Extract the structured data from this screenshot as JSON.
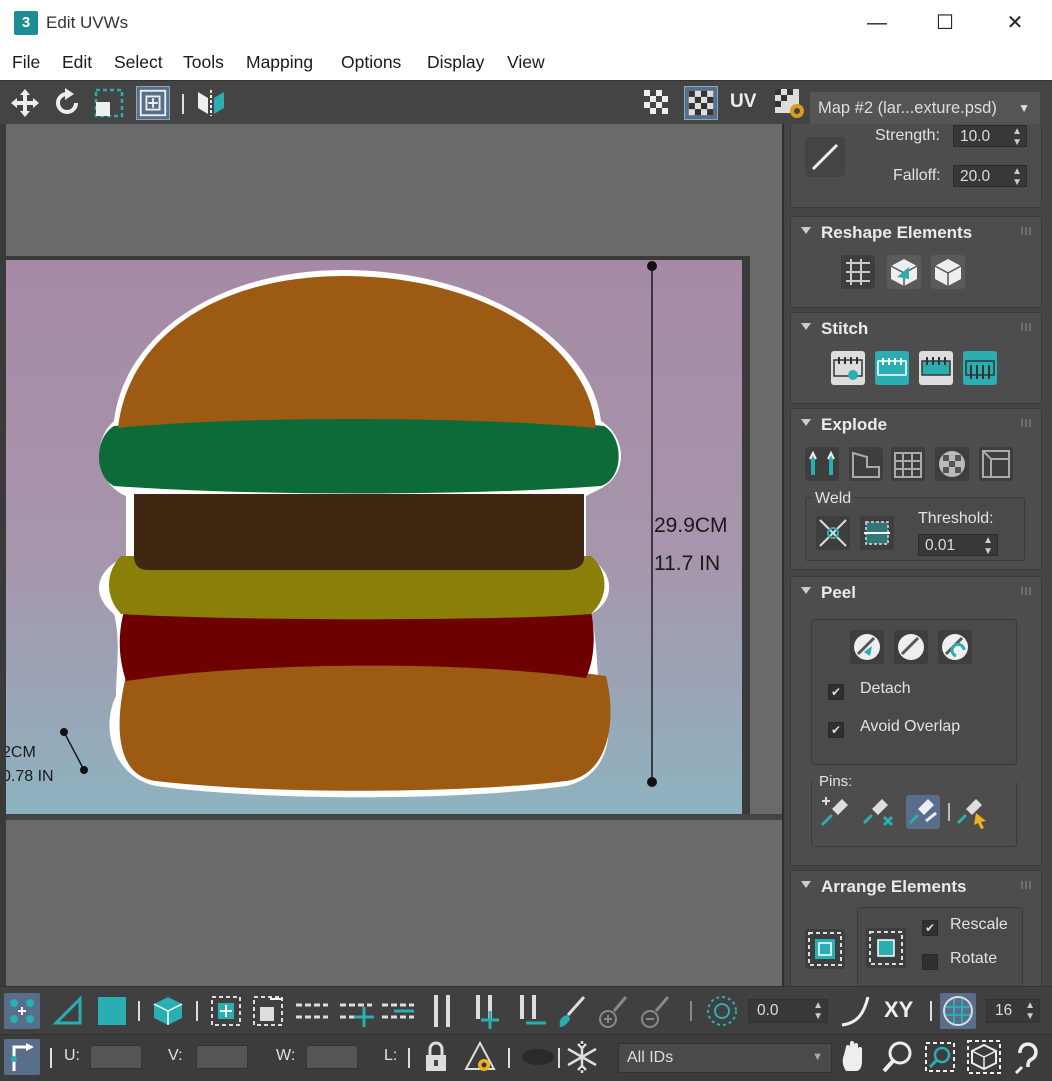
{
  "window": {
    "title": "Edit UVWs",
    "app_icon_text": "3",
    "minimize": "—",
    "maximize": "☐",
    "close": "✕"
  },
  "menu": [
    "File",
    "Edit",
    "Select",
    "Tools",
    "Mapping",
    "Options",
    "Display",
    "View"
  ],
  "toolbar": {
    "uv_label": "UV",
    "map_dropdown": "Map #2 (lar...exture.psd)",
    "dropdown_arrow": "▼"
  },
  "viewport": {
    "dim_large_cm": "29.9CM",
    "dim_large_in": "11.7 IN",
    "dim_small_cm": "2CM",
    "dim_small_in": "0.78 IN"
  },
  "panel": {
    "strength_label": "Strength:",
    "strength_value": "10.0",
    "falloff_label": "Falloff:",
    "falloff_value": "20.0",
    "reshape_title": "Reshape Elements",
    "stitch_title": "Stitch",
    "explode_title": "Explode",
    "weld_label": "Weld",
    "threshold_label": "Threshold:",
    "threshold_value": "0.01",
    "peel_title": "Peel",
    "detach_label": "Detach",
    "detach_checked": true,
    "avoid_overlap_label": "Avoid Overlap",
    "avoid_overlap_checked": true,
    "pins_label": "Pins:",
    "arrange_title": "Arrange Elements",
    "rescale_label": "Rescale",
    "rescale_checked": true,
    "rotate_label": "Rotate",
    "rotate_checked": false,
    "check_mark": "✔"
  },
  "bottom": {
    "angle_value": "0.0",
    "xy_label": "XY",
    "grid_value": "16",
    "u_label": "U:",
    "v_label": "V:",
    "w_label": "W:",
    "l_label": "L:",
    "ids_dropdown": "All IDs",
    "dropdown_arrow": "▼"
  },
  "colors": {
    "accent_teal": "#2aaeb1",
    "bun": "#9c5a12",
    "lettuce": "#0d6b3a",
    "patty": "#3f2712",
    "cheese": "#8a7f08",
    "tomato": "#6e0000",
    "background": "#444444"
  }
}
